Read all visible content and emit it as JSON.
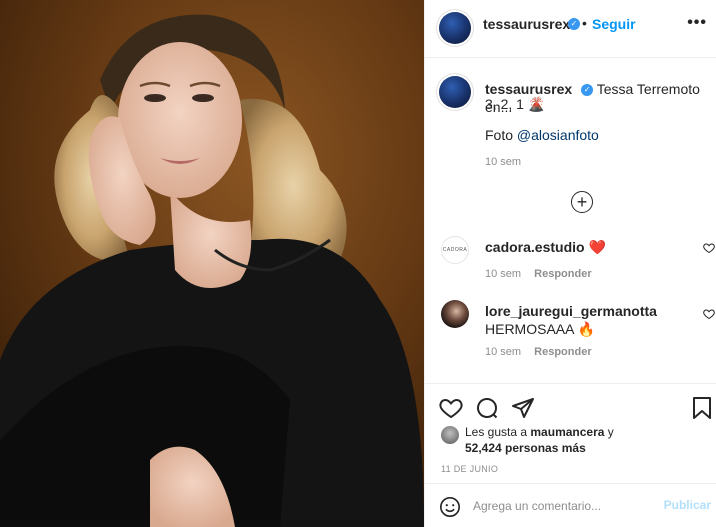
{
  "post": {
    "author": "tessaurusrex",
    "follow_label": "Seguir",
    "separator": "•",
    "more_label": "•••",
    "verified_mark": "✓"
  },
  "caption": {
    "author": "tessaurusrex",
    "text": "Tessa Terremoto en...",
    "line2": "3, 2, 1 🌋",
    "photo_credit_prefix": "Foto ",
    "photo_credit_mention": "@alosianfoto",
    "time": "10 sem"
  },
  "load_more_label": "+",
  "comments": [
    {
      "author": "cadora.estudio",
      "text": "❤️",
      "time": "10 sem",
      "reply_label": "Responder",
      "avatar_text": "CADORA"
    },
    {
      "author": "lore_jauregui_germanotta",
      "text": "HERMOSAAA 🔥",
      "time": "10 sem",
      "reply_label": "Responder"
    }
  ],
  "likes": {
    "prefix": "Les gusta a ",
    "first_liker": "maumancera",
    "connector": " y",
    "others": "52,424 personas más"
  },
  "date": "11 DE JUNIO",
  "add_comment": {
    "placeholder": "Agrega un comentario...",
    "publish_label": "Publicar"
  },
  "colors": {
    "accent": "#0095f6",
    "publish_disabled": "#b2dffc",
    "muted": "#8e8e8e",
    "verified": "#3897f0"
  }
}
